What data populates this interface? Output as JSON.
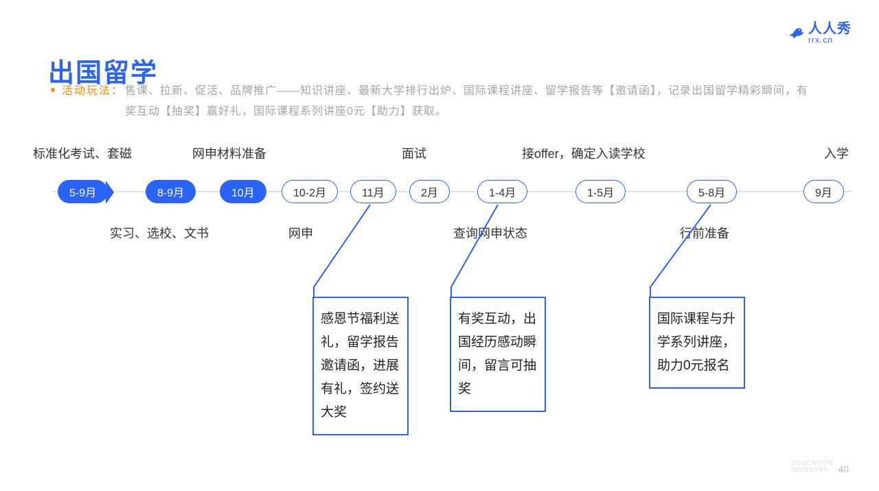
{
  "logo": {
    "text1": "人人秀",
    "text2": "rrx.cn"
  },
  "title": "出国留学",
  "desc_label": "活动玩法：",
  "desc_text": "售课、拉新、促活、品牌推广——知识讲座、最新大学排行出炉、国际课程讲座、留学报告等【邀请函】，记录出国留学精彩瞬间，有奖互动【抽奖】赢好礼，国际课程系列讲座0元【助力】获取。",
  "top_labels": {
    "l1": "标准化考试、套磁",
    "l2": "网申材料准备",
    "l3": "面试",
    "l4": "接offer，确定入读学校",
    "l5": "入学"
  },
  "bottom_labels": {
    "b1": "实习、选校、文书",
    "b2": "网申",
    "b3": "查询网申状态",
    "b4": "行前准备"
  },
  "timeline_nodes": [
    {
      "label": "5-9月"
    },
    {
      "label": "8-9月"
    },
    {
      "label": "10月"
    },
    {
      "label": "10-2月"
    },
    {
      "label": "11月"
    },
    {
      "label": "2月"
    },
    {
      "label": "1-4月"
    },
    {
      "label": "1-5月"
    },
    {
      "label": "5-8月"
    },
    {
      "label": "9月"
    }
  ],
  "callouts": {
    "c1": "感恩节福利送礼，留学报告邀请函，进展有礼，签约送大奖",
    "c2": "有奖互动，出国经历感动瞬间，留言可抽奖",
    "c3": "国际课程与升学系列讲座，助力0元报名"
  },
  "page_number": "40",
  "page_tag_l1": "EDUCATION",
  "page_tag_l2": "INDUSTRY",
  "colors": {
    "accent": "#2b63f7",
    "muted": "#a0a6b0",
    "orange": "#ff8a00"
  }
}
